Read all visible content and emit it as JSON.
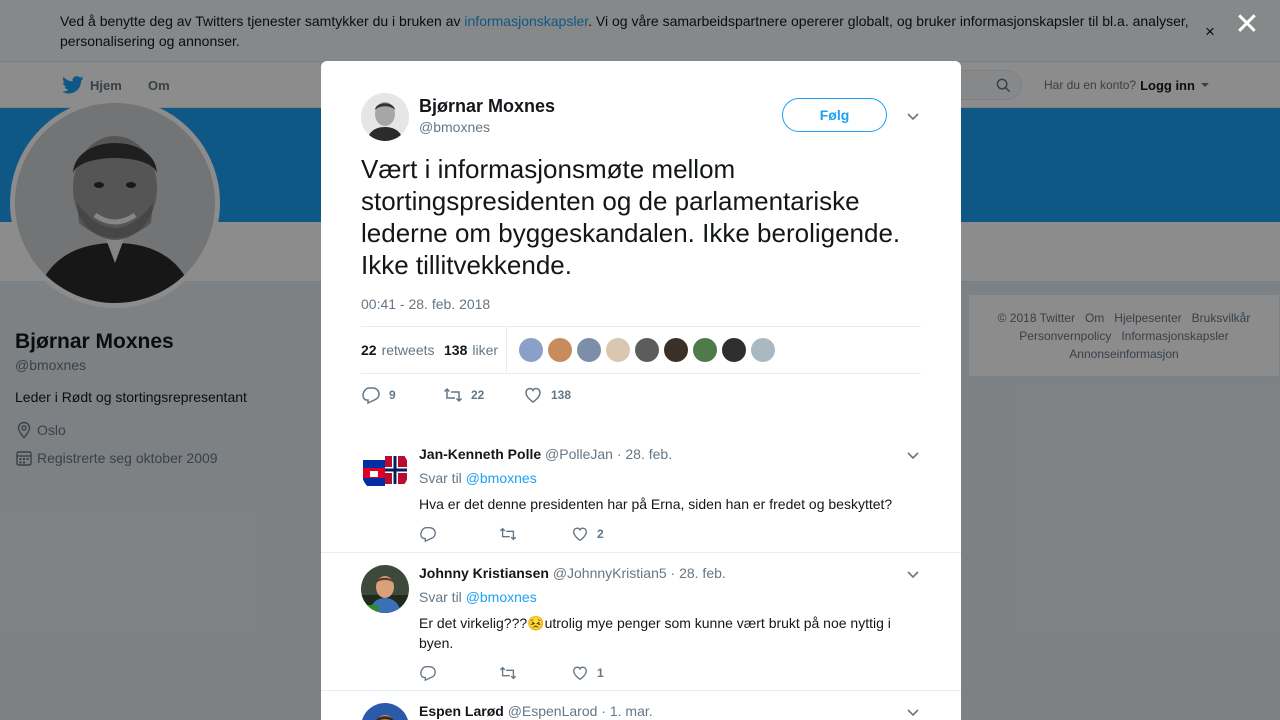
{
  "cookie": {
    "text_before": "Ved å benytte deg av Twitters tjenester samtykker du i bruken av ",
    "link": "informasjonskapsler",
    "text_after": ". Vi og våre samarbeidspartnere opererer globalt, og bruker informasjonskapsler til bl.a. analyser, personalisering og annonser.",
    "close": "×"
  },
  "nav": {
    "home": "Hjem",
    "about": "Om",
    "login_prompt": "Har du en konto?",
    "login": "Logg inn"
  },
  "profile": {
    "name": "Bjørnar Moxnes",
    "handle": "@bmoxnes",
    "bio": "Leder i Rødt og stortingsrepresentant",
    "location": "Oslo",
    "joined": "Registrerte seg oktober 2009"
  },
  "footer": [
    "© 2018 Twitter",
    "Om",
    "Hjelpesenter",
    "Bruksvilkår",
    "Personvernpolicy",
    "Informasjonskapsler",
    "Annonseinformasjon"
  ],
  "modal": {
    "close": "✕",
    "name": "Bjørnar Moxnes",
    "handle": "@bmoxnes",
    "follow": "Følg",
    "text": "Vært i informasjonsmøte mellom stortingspresidenten og de parlamentariske lederne om byggeskandalen. Ikke beroligende. Ikke tillitvekkende.",
    "time": "00:41 - 28. feb. 2018",
    "retweets_count": "22",
    "retweets_label": "retweets",
    "likes_count": "138",
    "likes_label": "liker",
    "liker_colors": [
      "#8aa0c8",
      "#c98b5e",
      "#7d8fa8",
      "#d9c7b0",
      "#5c5c5c",
      "#3a3028",
      "#4f7a4a",
      "#2f2f2f",
      "#aab8c2"
    ],
    "actions": {
      "replies": "9",
      "retweets": "22",
      "likes": "138"
    }
  },
  "replies": [
    {
      "name": "Jan-Kenneth Polle",
      "handle": "@PolleJan",
      "date": "· 28. feb.",
      "reply_to_label": "Svar til",
      "reply_to": "@bmoxnes",
      "text": "Hva er det denne presidenten har på Erna, siden han er fredet og beskyttet?",
      "replies": "",
      "retweets": "",
      "likes": "2"
    },
    {
      "name": "Johnny Kristiansen",
      "handle": "@JohnnyKristian5",
      "date": "· 28. feb.",
      "reply_to_label": "Svar til",
      "reply_to": "@bmoxnes",
      "text": "Er det virkelig???😣utrolig mye penger som kunne vært brukt på noe nyttig i byen.",
      "replies": "",
      "retweets": "",
      "likes": "1"
    },
    {
      "name": "Espen Larød",
      "handle": "@EspenLarod",
      "date": "· 1. mar."
    }
  ]
}
